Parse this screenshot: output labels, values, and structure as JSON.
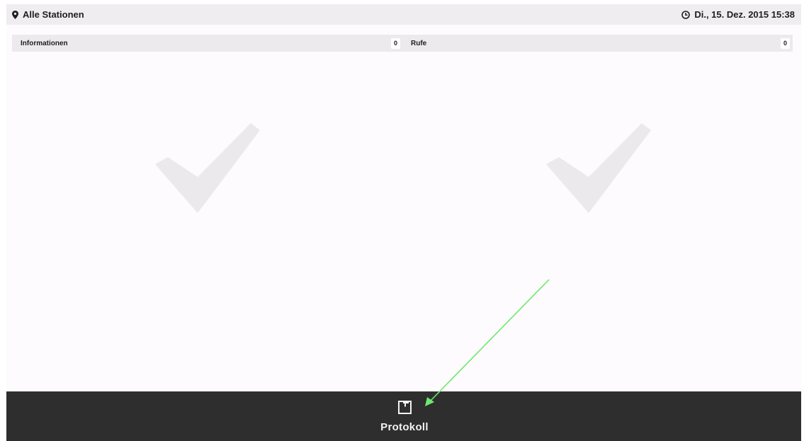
{
  "header": {
    "location_icon": "map-pin-icon",
    "title": "Alle Stationen",
    "clock_icon": "clock-icon",
    "datetime": "Di., 15. Dez. 2015 15:38"
  },
  "panels": {
    "informationen": {
      "label": "Informationen",
      "count": "0",
      "status_icon": "checkmark-icon"
    },
    "rufe": {
      "label": "Rufe",
      "count": "0",
      "status_icon": "checkmark-icon"
    }
  },
  "footer": {
    "protokoll": {
      "label": "Protokoll",
      "icon": "book-icon"
    }
  },
  "colors": {
    "topbar_bg": "#efedef",
    "panel_header_bg": "#edeaed",
    "content_bg": "#fdfbfd",
    "checkmark": "#ece9ec",
    "footer_bg": "#2e2e2e",
    "annotation_arrow": "#6ee86e"
  }
}
